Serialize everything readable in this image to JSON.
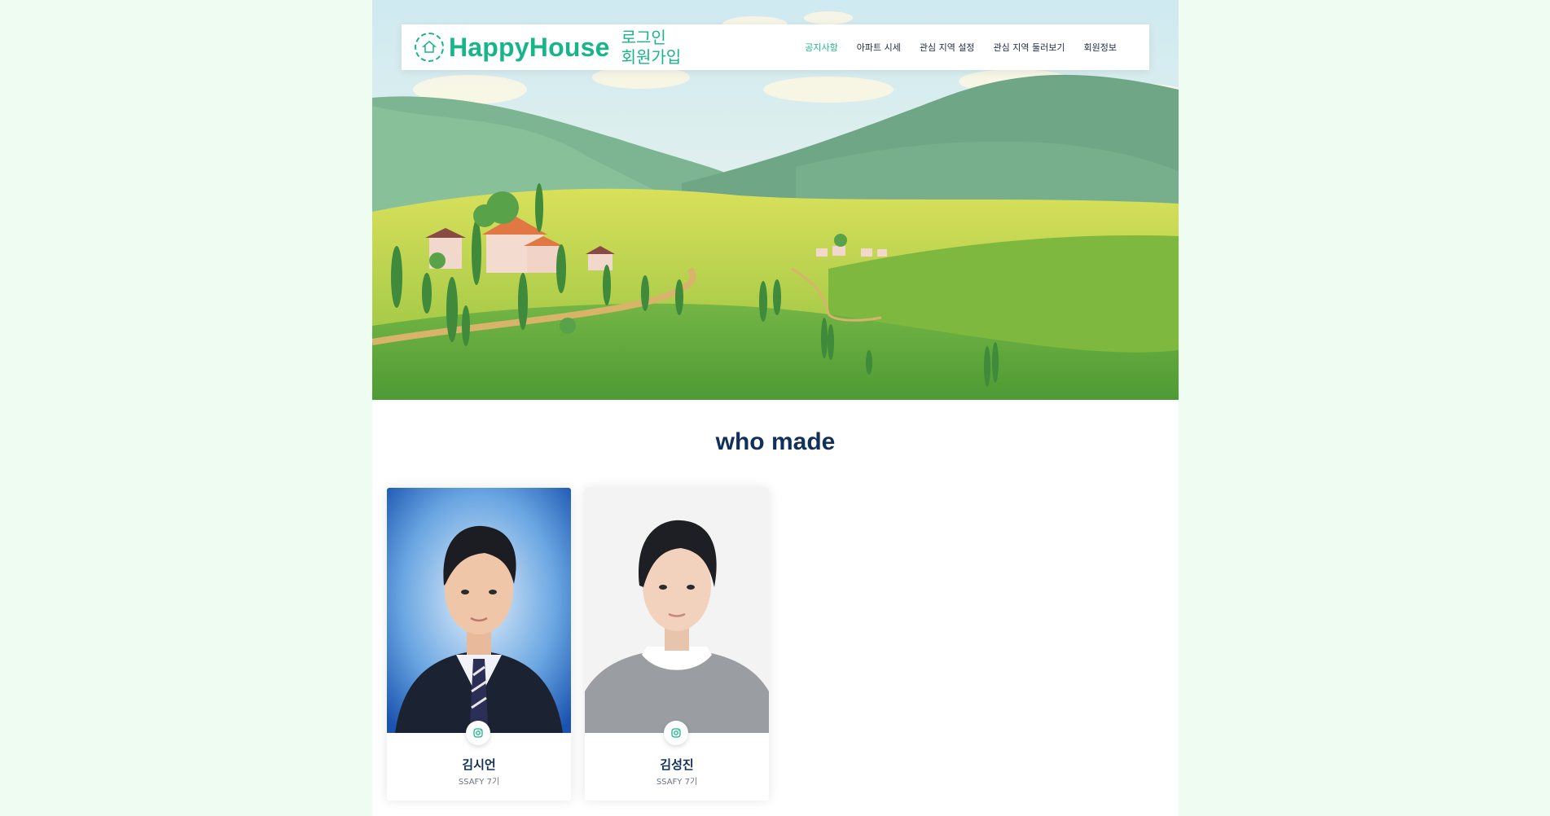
{
  "brand": {
    "name": "HappyHouse",
    "accent": "#19b58a"
  },
  "auth": {
    "login": "로그인",
    "signup": "회원가입"
  },
  "nav": {
    "items": [
      {
        "label": "공지사항",
        "active": true
      },
      {
        "label": "아파트 시세",
        "active": false
      },
      {
        "label": "관심 지역 설정",
        "active": false
      },
      {
        "label": "관심 지역 둘러보기",
        "active": false
      },
      {
        "label": "회원정보",
        "active": false
      }
    ]
  },
  "section": {
    "title": "who made"
  },
  "team": [
    {
      "name": "김시언",
      "role": "SSAFY 7기",
      "icon": "instagram-icon",
      "background": "#1e5fb8"
    },
    {
      "name": "김성진",
      "role": "SSAFY 7기",
      "icon": "instagram-icon",
      "background": "#f2f2f2"
    }
  ]
}
